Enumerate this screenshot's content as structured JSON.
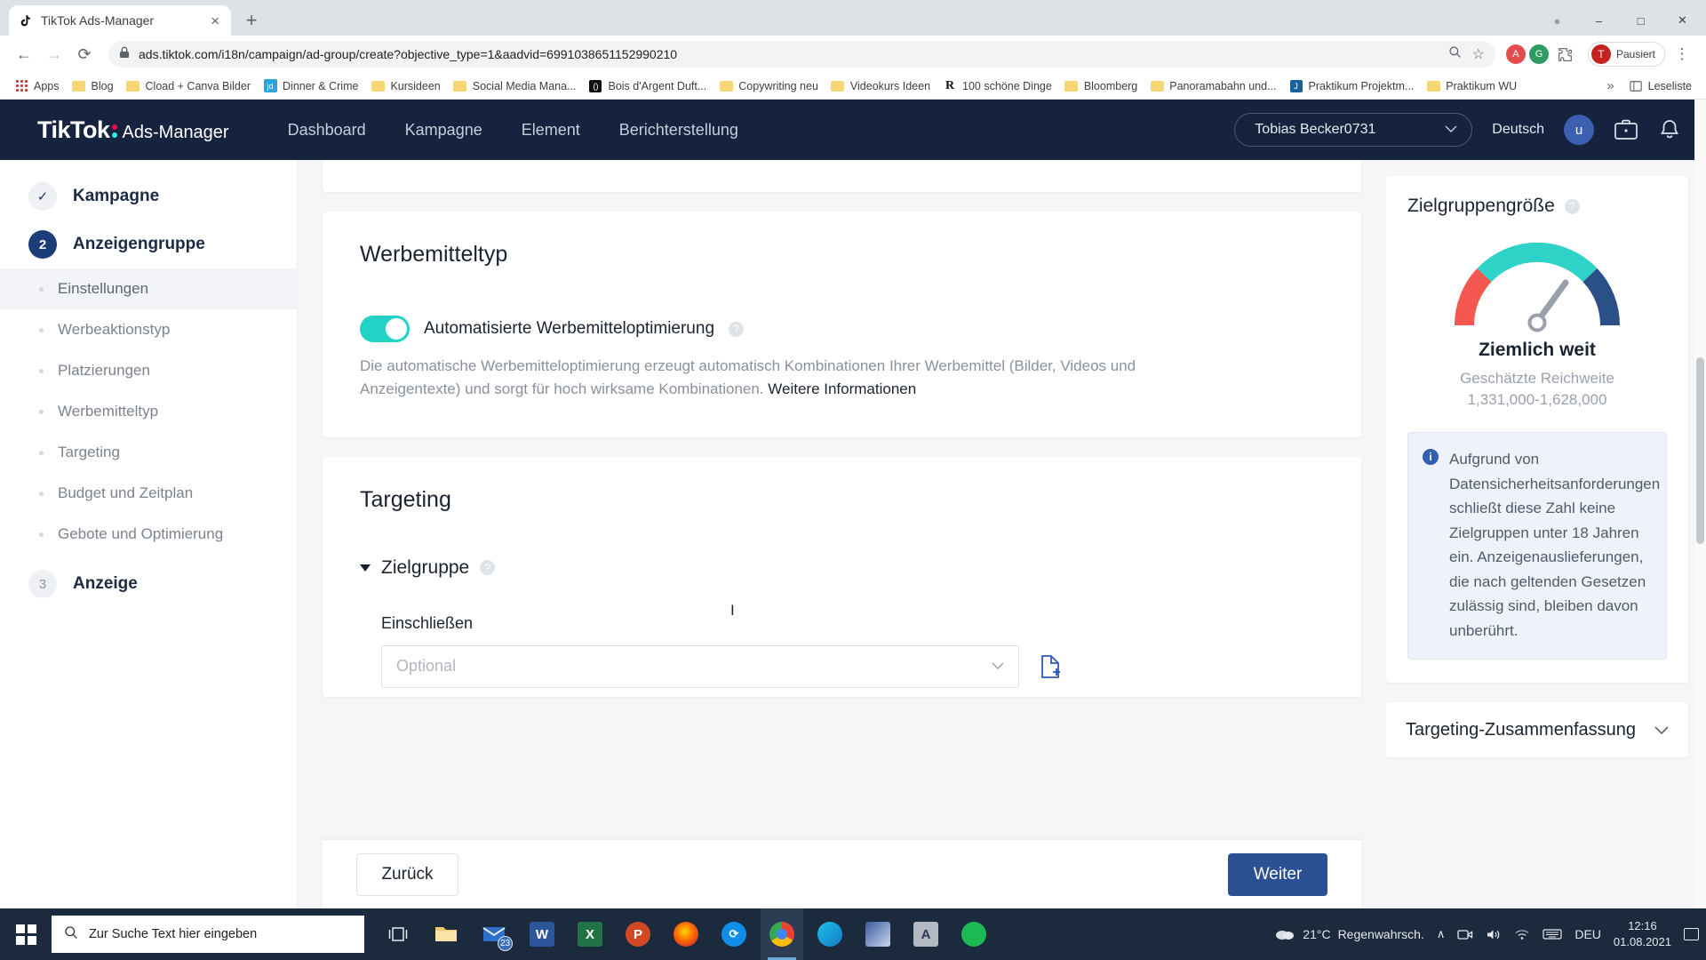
{
  "browser": {
    "tab": {
      "title": "TikTok Ads-Manager",
      "favicon": "tiktok-icon",
      "close": "×"
    },
    "new_tab": "+",
    "window_controls": {
      "minimize": "–",
      "maximize": "□",
      "close": "✕",
      "record": "●"
    },
    "nav": {
      "back": "←",
      "forward": "→",
      "reload": "⟳",
      "lock": "lock-icon"
    },
    "url": "ads.tiktok.com/i18n/campaign/ad-group/create?objective_type=1&aadvid=6991038651152990210",
    "omni_actions": {
      "zoom": "⊕",
      "bookmark_star": "☆",
      "menu": "⋮"
    },
    "profile": {
      "initial": "T",
      "label": "Pausiert"
    },
    "bookmarks": [
      {
        "label": "Apps",
        "icon": "apps-grid-icon"
      },
      {
        "label": "Blog",
        "icon": "folder-icon"
      },
      {
        "label": "Cload + Canva Bilder",
        "icon": "folder-icon"
      },
      {
        "label": "Dinner & Crime",
        "icon": "jd-icon"
      },
      {
        "label": "Kursideen",
        "icon": "folder-icon"
      },
      {
        "label": "Social Media Mana...",
        "icon": "folder-icon"
      },
      {
        "label": "Bois d'Argent Duft...",
        "icon": "dark-circle-icon"
      },
      {
        "label": "Copywriting neu",
        "icon": "folder-icon"
      },
      {
        "label": "Videokurs Ideen",
        "icon": "folder-icon"
      },
      {
        "label": "100 schöne Dinge",
        "icon": "r-icon"
      },
      {
        "label": "Bloomberg",
        "icon": "folder-icon"
      },
      {
        "label": "Panoramabahn und...",
        "icon": "folder-icon"
      },
      {
        "label": "Praktikum Projektm...",
        "icon": "blue-doc-icon"
      },
      {
        "label": "Praktikum WU",
        "icon": "folder-icon"
      }
    ],
    "bookmarks_overflow": "»",
    "reading_list": "Leseliste"
  },
  "tiktok_header": {
    "logo_main": "TikTok",
    "logo_sub": "Ads-Manager",
    "nav": [
      {
        "label": "Dashboard"
      },
      {
        "label": "Kampagne"
      },
      {
        "label": "Element"
      },
      {
        "label": "Berichterstellung"
      }
    ],
    "account": "Tobias Becker0731",
    "language": "Deutsch",
    "avatar_initial": "u",
    "icons": [
      "briefcase-icon",
      "bell-icon"
    ]
  },
  "leftnav": {
    "steps": [
      {
        "badge": "✓",
        "label": "Kampagne",
        "state": "done"
      },
      {
        "badge": "2",
        "label": "Anzeigengruppe",
        "state": "active"
      },
      {
        "badge": "3",
        "label": "Anzeige",
        "state": "future"
      }
    ],
    "subitems": [
      {
        "label": "Einstellungen",
        "selected": true
      },
      {
        "label": "Werbeaktionstyp",
        "selected": false
      },
      {
        "label": "Platzierungen",
        "selected": false
      },
      {
        "label": "Werbemitteltyp",
        "selected": false
      },
      {
        "label": "Targeting",
        "selected": false
      },
      {
        "label": "Budget und Zeitplan",
        "selected": false
      },
      {
        "label": "Gebote und Optimierung",
        "selected": false
      }
    ]
  },
  "main": {
    "creative_section": {
      "title": "Werbemitteltyp",
      "toggle_label": "Automatisierte Werbemitteloptimierung",
      "toggle_on": true,
      "toggle_color": "#22d3c5",
      "help_text": "Die automatische Werbemitteloptimierung erzeugt automatisch Kombinationen Ihrer Werbemittel (Bilder, Videos und Anzeigentexte) und sorgt für hoch wirksame Kombinationen.",
      "help_link": "Weitere Informationen",
      "tooltip_icon": "question-icon"
    },
    "targeting_section": {
      "title": "Targeting",
      "group_label": "Zielgruppe",
      "tooltip_icon": "question-icon",
      "include_label": "Einschließen",
      "include_placeholder": "Optional",
      "include_value": "",
      "upload_icon": "upload-file-icon"
    },
    "footer": {
      "back": "Zurück",
      "next": "Weiter",
      "next_color": "#2b5194"
    }
  },
  "rightpanel": {
    "audience_title": "Zielgruppengröße",
    "tooltip_icon": "question-icon",
    "gauge_status": "Ziemlich weit",
    "reach_label": "Geschätzte Reichweite",
    "reach_value": "1,331,000-1,628,000",
    "gauge_colors": {
      "low": "#f4574f",
      "mid": "#2ed2c7",
      "high": "#2b4f87"
    },
    "info_icon": "info-icon",
    "info_text": "Aufgrund von Datensicherheitsanforderungen schließt diese Zahl keine Zielgruppen unter 18 Jahren ein. Anzeigenauslieferungen, die nach geltenden Gesetzen zulässig sind, bleiben davon unberührt.",
    "summary_title": "Targeting-Zusammenfassung",
    "summary_chevron": "chevron-down-icon"
  },
  "taskbar": {
    "start_icon": "windows-icon",
    "search_placeholder": "Zur Suche Text hier eingeben",
    "search_icon": "search-icon",
    "items": [
      {
        "name": "task-view-icon",
        "glyph": "⌸",
        "color": "#ffffff",
        "bg": "transparent"
      },
      {
        "name": "file-explorer-icon",
        "glyph": "",
        "color": "#ffffff",
        "bg": "#f7c66b"
      },
      {
        "name": "mail-icon",
        "glyph": "",
        "color": "#ffffff",
        "bg": "#2b6ecb",
        "badge": "23"
      },
      {
        "name": "word-icon",
        "glyph": "W",
        "color": "#ffffff",
        "bg": "#2b579a"
      },
      {
        "name": "excel-icon",
        "glyph": "X",
        "color": "#ffffff",
        "bg": "#217346"
      },
      {
        "name": "powerpoint-icon",
        "glyph": "P",
        "color": "#ffffff",
        "bg": "#d24726"
      },
      {
        "name": "firefox-icon",
        "glyph": "",
        "color": "#ffffff",
        "bg": "#e66000"
      },
      {
        "name": "teamviewer-icon",
        "glyph": "",
        "color": "#ffffff",
        "bg": "#0e8ee9"
      },
      {
        "name": "chrome-icon",
        "glyph": "",
        "color": "#ffffff",
        "bg": "#e84234",
        "active": true
      },
      {
        "name": "edge-icon",
        "glyph": "",
        "color": "#ffffff",
        "bg": "#0f9bd7"
      },
      {
        "name": "photos-icon",
        "glyph": "",
        "color": "#ffffff",
        "bg": "#2b4a8b"
      },
      {
        "name": "acrobat-icon",
        "glyph": "A",
        "color": "#ffffff",
        "bg": "#b0b7c0"
      },
      {
        "name": "spotify-icon",
        "glyph": "",
        "color": "#ffffff",
        "bg": "#1db954"
      }
    ],
    "tray": {
      "weather_temp": "21°C",
      "weather_desc": "Regenwahrsch.",
      "chevron": "∧",
      "icons": [
        "camera-icon",
        "volume-icon",
        "wifi-icon",
        "keyboard-icon"
      ],
      "language": "DEU",
      "time": "12:16",
      "date": "01.08.2021",
      "action_center": "notification-icon"
    }
  }
}
